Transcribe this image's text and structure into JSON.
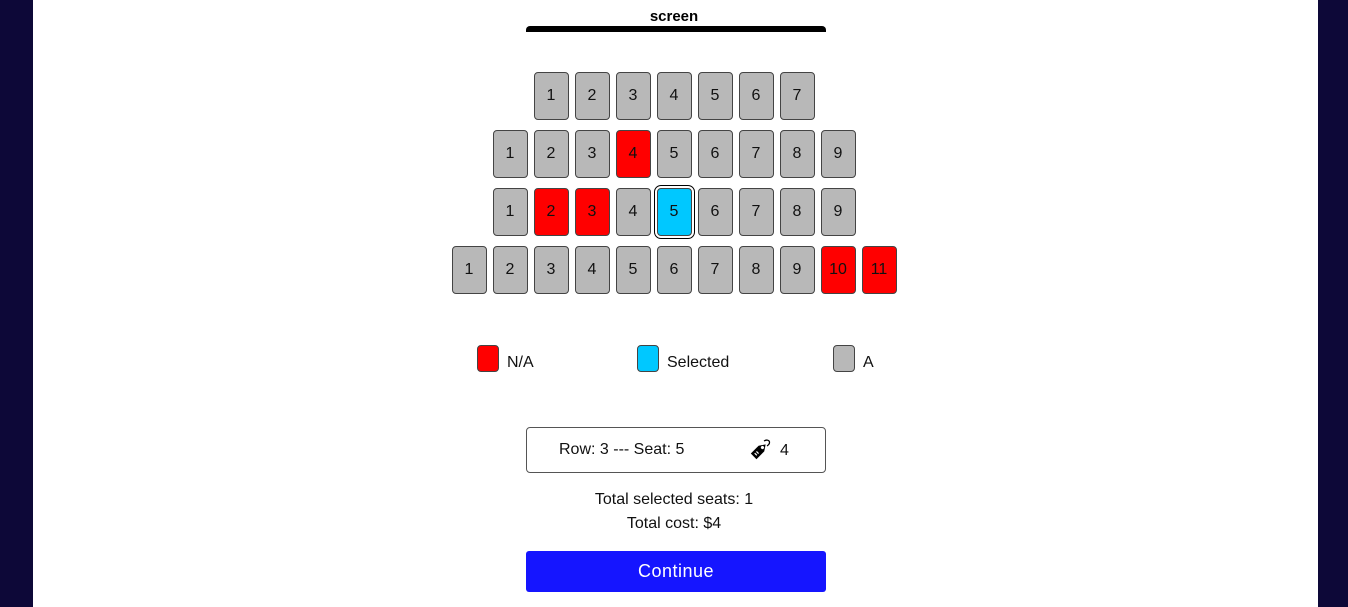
{
  "screen_label": "screen",
  "rows": [
    {
      "seats": [
        {
          "n": "1",
          "s": "a"
        },
        {
          "n": "2",
          "s": "a"
        },
        {
          "n": "3",
          "s": "a"
        },
        {
          "n": "4",
          "s": "a"
        },
        {
          "n": "5",
          "s": "a"
        },
        {
          "n": "6",
          "s": "a"
        },
        {
          "n": "7",
          "s": "a"
        }
      ]
    },
    {
      "seats": [
        {
          "n": "1",
          "s": "a"
        },
        {
          "n": "2",
          "s": "a"
        },
        {
          "n": "3",
          "s": "a"
        },
        {
          "n": "4",
          "s": "na"
        },
        {
          "n": "5",
          "s": "a"
        },
        {
          "n": "6",
          "s": "a"
        },
        {
          "n": "7",
          "s": "a"
        },
        {
          "n": "8",
          "s": "a"
        },
        {
          "n": "9",
          "s": "a"
        }
      ]
    },
    {
      "seats": [
        {
          "n": "1",
          "s": "a"
        },
        {
          "n": "2",
          "s": "na"
        },
        {
          "n": "3",
          "s": "na"
        },
        {
          "n": "4",
          "s": "a"
        },
        {
          "n": "5",
          "s": "selected"
        },
        {
          "n": "6",
          "s": "a"
        },
        {
          "n": "7",
          "s": "a"
        },
        {
          "n": "8",
          "s": "a"
        },
        {
          "n": "9",
          "s": "a"
        }
      ]
    },
    {
      "seats": [
        {
          "n": "1",
          "s": "a"
        },
        {
          "n": "2",
          "s": "a"
        },
        {
          "n": "3",
          "s": "a"
        },
        {
          "n": "4",
          "s": "a"
        },
        {
          "n": "5",
          "s": "a"
        },
        {
          "n": "6",
          "s": "a"
        },
        {
          "n": "7",
          "s": "a"
        },
        {
          "n": "8",
          "s": "a"
        },
        {
          "n": "9",
          "s": "a"
        },
        {
          "n": "10",
          "s": "na"
        },
        {
          "n": "11",
          "s": "na"
        }
      ]
    }
  ],
  "legend": {
    "na_label": "N/A",
    "selected_label": "Selected",
    "available_label": "A"
  },
  "colors": {
    "available": "#b8b8b8",
    "na": "#ff0000",
    "selected": "#00c8ff",
    "button": "#1515ff",
    "background": "#0d0838"
  },
  "selection": {
    "label": "Row: 3 --- Seat: 5",
    "icon": "price-tag-icon",
    "price": "4"
  },
  "totals": {
    "seats_text": "Total selected seats: 1",
    "cost_text": "Total cost: $4"
  },
  "continue_label": "Continue"
}
